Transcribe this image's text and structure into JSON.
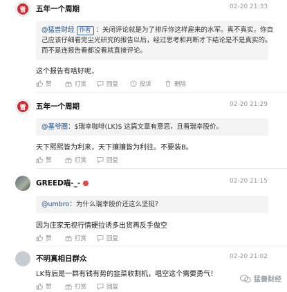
{
  "comments": [
    {
      "user": "五年一个周期",
      "time": "02-20 21:33",
      "quote": {
        "name": "@猛兽财经",
        "tag": "作者",
        "text_lines": [
          "：关闭评论就是为了排斥你这样雇来的水军。真不真实，你自",
          "己应该仔细看完尘光研究的报告以后，经过思考和判断才下结论是不是真实的。",
          "而不是连报告看都没看就直接评论。"
        ]
      },
      "body": "这个报告有啥好呢，",
      "actions": {
        "like": "赞",
        "tip": "打赏",
        "reply": "回复",
        "complain": "投诉",
        "delete": "删除"
      }
    },
    {
      "user": "五年一个周期",
      "time": "02-20 21:29",
      "quote": {
        "name": "@基爷圈",
        "text": "：$瑞幸咖啡(LK)$ 这篇文章有意思，且看瑞幸股价。"
      },
      "body": "天下熙熙皆为利来，天下攘攘皆为利往。不要装B。",
      "actions": {
        "like": "赞",
        "tip": "打赏",
        "reply": "回复"
      }
    },
    {
      "user": "GREED喵-_-",
      "time": "02-20 21:15",
      "quote": {
        "name": "@umbro",
        "text": "：为什么瑞幸股价还这么坚挺?"
      },
      "body": "因为庄家无视行情硬拉诱多出货再反手做空",
      "actions": {
        "like": "赞",
        "tip": "打赏",
        "reply": "回复"
      }
    },
    {
      "user": "不明真相日群众",
      "time": "02-20 21:02",
      "body": "LK背后是一群有钱有势的韭菜收割机，唱空这个需要勇气！",
      "actions": {
        "like": "赞",
        "tip": "打赏",
        "reply": "回复"
      }
    }
  ],
  "avatar_logo_text": "雪",
  "watermark": "猛兽财经",
  "colors": {
    "link": "#1a4d88",
    "tag": "#3a66a8",
    "badge": "#e04848",
    "avatar_logo": "#d2282e"
  }
}
